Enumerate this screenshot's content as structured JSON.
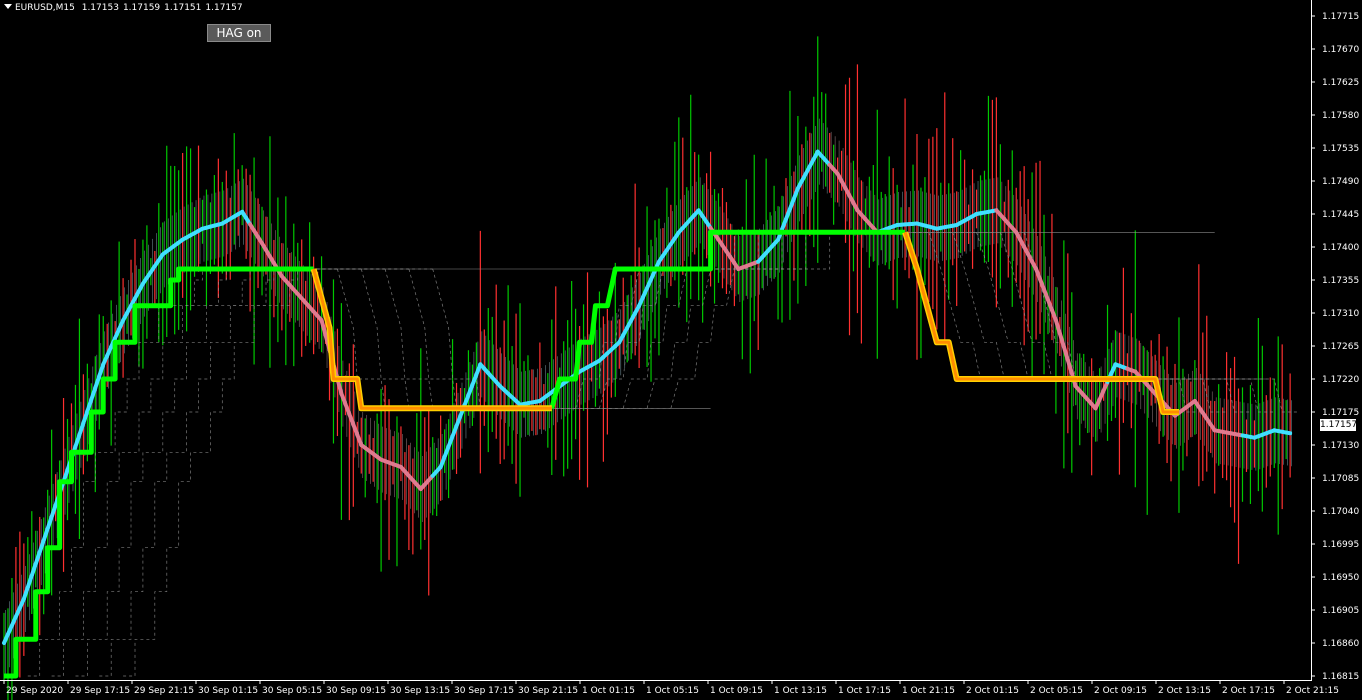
{
  "header": {
    "symbol": "EURUSD,M15",
    "ohlc": [
      "1.17153",
      "1.17159",
      "1.17151",
      "1.17157"
    ]
  },
  "hag_button": {
    "label": "HAG on"
  },
  "chart_data": {
    "type": "line",
    "y_axis_labels": [
      "1.17715",
      "1.17670",
      "1.17625",
      "1.17580",
      "1.17535",
      "1.17490",
      "1.17445",
      "1.17400",
      "1.17355",
      "1.17310",
      "1.17265",
      "1.17220",
      "1.17175",
      "1.17130",
      "1.17085",
      "1.17040",
      "1.16995",
      "1.16950",
      "1.16905",
      "1.16860",
      "1.16815"
    ],
    "x_axis_labels": [
      "29 Sep 2020",
      "29 Sep 17:15",
      "29 Sep 21:15",
      "30 Sep 01:15",
      "30 Sep 05:15",
      "30 Sep 09:15",
      "30 Sep 13:15",
      "30 Sep 17:15",
      "30 Sep 21:15",
      "1 Oct 01:15",
      "1 Oct 05:15",
      "1 Oct 09:15",
      "1 Oct 13:15",
      "1 Oct 17:15",
      "1 Oct 21:15",
      "2 Oct 01:15",
      "2 Oct 05:15",
      "2 Oct 09:15",
      "2 Oct 13:15",
      "2 Oct 17:15",
      "2 Oct 21:15"
    ],
    "current_price": "1.17157",
    "ylim": [
      1.16815,
      1.17715
    ],
    "colors": {
      "up": "#00c800",
      "down": "#ff3030",
      "ma_up": "#40e0ff",
      "ma_down": "#e07a90",
      "stop_up": "#00ff00",
      "stop_down": "#ff8c00",
      "stop_down_edge": "#ffd000"
    },
    "ma_line": [
      [
        0,
        1.1686
      ],
      [
        5,
        1.1692
      ],
      [
        10,
        1.17
      ],
      [
        15,
        1.1708
      ],
      [
        20,
        1.1716
      ],
      [
        25,
        1.1724
      ],
      [
        30,
        1.173
      ],
      [
        35,
        1.1735
      ],
      [
        40,
        1.1739
      ],
      [
        45,
        1.1741
      ],
      [
        50,
        1.17425
      ],
      [
        55,
        1.17432
      ],
      [
        60,
        1.17448
      ],
      [
        65,
        1.17405
      ],
      [
        70,
        1.1736
      ],
      [
        75,
        1.1733
      ],
      [
        80,
        1.173
      ],
      [
        85,
        1.172
      ],
      [
        90,
        1.1713
      ],
      [
        95,
        1.1711
      ],
      [
        100,
        1.171
      ],
      [
        105,
        1.1707
      ],
      [
        110,
        1.171
      ],
      [
        115,
        1.1717
      ],
      [
        120,
        1.1724
      ],
      [
        125,
        1.1721
      ],
      [
        130,
        1.17185
      ],
      [
        135,
        1.1719
      ],
      [
        140,
        1.1721
      ],
      [
        145,
        1.1723
      ],
      [
        150,
        1.17245
      ],
      [
        155,
        1.1727
      ],
      [
        160,
        1.1732
      ],
      [
        165,
        1.1738
      ],
      [
        170,
        1.1742
      ],
      [
        175,
        1.1745
      ],
      [
        180,
        1.1741
      ],
      [
        185,
        1.1737
      ],
      [
        190,
        1.1738
      ],
      [
        195,
        1.1741
      ],
      [
        200,
        1.1748
      ],
      [
        205,
        1.1753
      ],
      [
        210,
        1.175
      ],
      [
        215,
        1.1745
      ],
      [
        220,
        1.1742
      ],
      [
        225,
        1.1743
      ],
      [
        230,
        1.17432
      ],
      [
        235,
        1.17425
      ],
      [
        240,
        1.1743
      ],
      [
        245,
        1.17445
      ],
      [
        250,
        1.1745
      ],
      [
        255,
        1.1742
      ],
      [
        260,
        1.1737
      ],
      [
        265,
        1.173
      ],
      [
        270,
        1.1721
      ],
      [
        275,
        1.1718
      ],
      [
        280,
        1.1724
      ],
      [
        285,
        1.1723
      ],
      [
        290,
        1.172
      ],
      [
        295,
        1.1717
      ],
      [
        300,
        1.1719
      ],
      [
        305,
        1.1715
      ],
      [
        310,
        1.17145
      ],
      [
        315,
        1.1714
      ],
      [
        320,
        1.1715
      ],
      [
        325,
        1.17145
      ]
    ],
    "ma_direction": [
      [
        0,
        "up"
      ],
      [
        62,
        "down"
      ],
      [
        108,
        "up"
      ],
      [
        178,
        "down"
      ],
      [
        190,
        "up"
      ],
      [
        208,
        "down"
      ],
      [
        220,
        "up"
      ],
      [
        250,
        "down"
      ],
      [
        278,
        "up"
      ],
      [
        283,
        "down"
      ],
      [
        312,
        "up"
      ]
    ],
    "stop_line_up_1": [
      [
        0,
        1.16815
      ],
      [
        3,
        1.16815
      ],
      [
        3,
        1.16865
      ],
      [
        8,
        1.16865
      ],
      [
        8,
        1.1693
      ],
      [
        11,
        1.1693
      ],
      [
        11,
        1.1699
      ],
      [
        14,
        1.1699
      ],
      [
        14,
        1.1708
      ],
      [
        17,
        1.1708
      ],
      [
        17,
        1.1712
      ],
      [
        22,
        1.1712
      ],
      [
        22,
        1.17175
      ],
      [
        25,
        1.17175
      ],
      [
        25,
        1.1722
      ],
      [
        28,
        1.1722
      ],
      [
        28,
        1.1727
      ],
      [
        33,
        1.1727
      ],
      [
        33,
        1.1732
      ],
      [
        42,
        1.1732
      ],
      [
        42,
        1.17355
      ],
      [
        44,
        1.17355
      ],
      [
        44,
        1.1737
      ],
      [
        78,
        1.1737
      ]
    ],
    "stop_line_down_1": [
      [
        78,
        1.1737
      ],
      [
        80,
        1.1733
      ],
      [
        82,
        1.1729
      ],
      [
        83,
        1.1722
      ],
      [
        89,
        1.1722
      ],
      [
        90,
        1.1718
      ],
      [
        138,
        1.1718
      ]
    ],
    "stop_line_up_2": [
      [
        138,
        1.1718
      ],
      [
        140,
        1.1722
      ],
      [
        144,
        1.1722
      ],
      [
        145,
        1.1727
      ],
      [
        148,
        1.1727
      ],
      [
        149,
        1.1732
      ],
      [
        152,
        1.1732
      ],
      [
        154,
        1.1737
      ],
      [
        178,
        1.1737
      ],
      [
        178,
        1.1742
      ],
      [
        227,
        1.1742
      ]
    ],
    "stop_line_down_2": [
      [
        227,
        1.1742
      ],
      [
        230,
        1.1737
      ],
      [
        232,
        1.1733
      ],
      [
        235,
        1.1727
      ],
      [
        238,
        1.1727
      ],
      [
        240,
        1.1722
      ],
      [
        290,
        1.1722
      ],
      [
        292,
        1.17175
      ],
      [
        296,
        1.17175
      ]
    ],
    "bars_count": 300
  }
}
